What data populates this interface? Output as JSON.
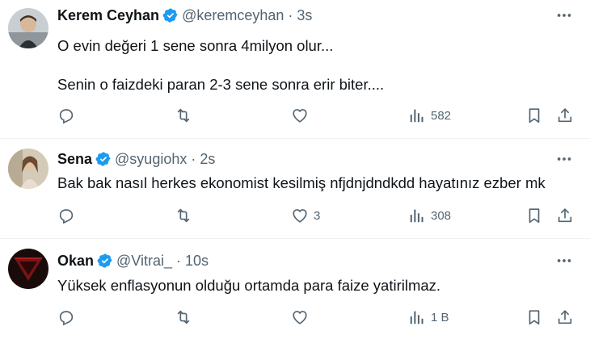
{
  "colors": {
    "text": "#0f1419",
    "secondary": "#536471",
    "verified": "#1d9bf0",
    "divider": "#eff3f4"
  },
  "tweets": [
    {
      "name": "Kerem Ceyhan",
      "handle": "@keremceyhan",
      "separator": "·",
      "time": "3s",
      "lines": [
        "O evin değeri 1 sene sonra 4milyon olur...",
        "Senin o faizdeki paran 2-3 sene sonra erir biter...."
      ],
      "reply_count": "",
      "retweet_count": "",
      "like_count": "",
      "view_count": "582"
    },
    {
      "name": "Sena",
      "handle": "@syugiohx",
      "separator": "·",
      "time": "2s",
      "lines": [
        "Bak bak nasıl herkes ekonomist kesilmiş nfjdnjdndkdd hayatınız ezber mk"
      ],
      "reply_count": "",
      "retweet_count": "",
      "like_count": "3",
      "view_count": "308"
    },
    {
      "name": "Okan",
      "handle": "@Vitrai_",
      "separator": "·",
      "time": "10s",
      "lines": [
        "Yüksek enflasyonun olduğu ortamda para faize yatirilmaz."
      ],
      "reply_count": "",
      "retweet_count": "",
      "like_count": "",
      "view_count": "1 B"
    }
  ]
}
